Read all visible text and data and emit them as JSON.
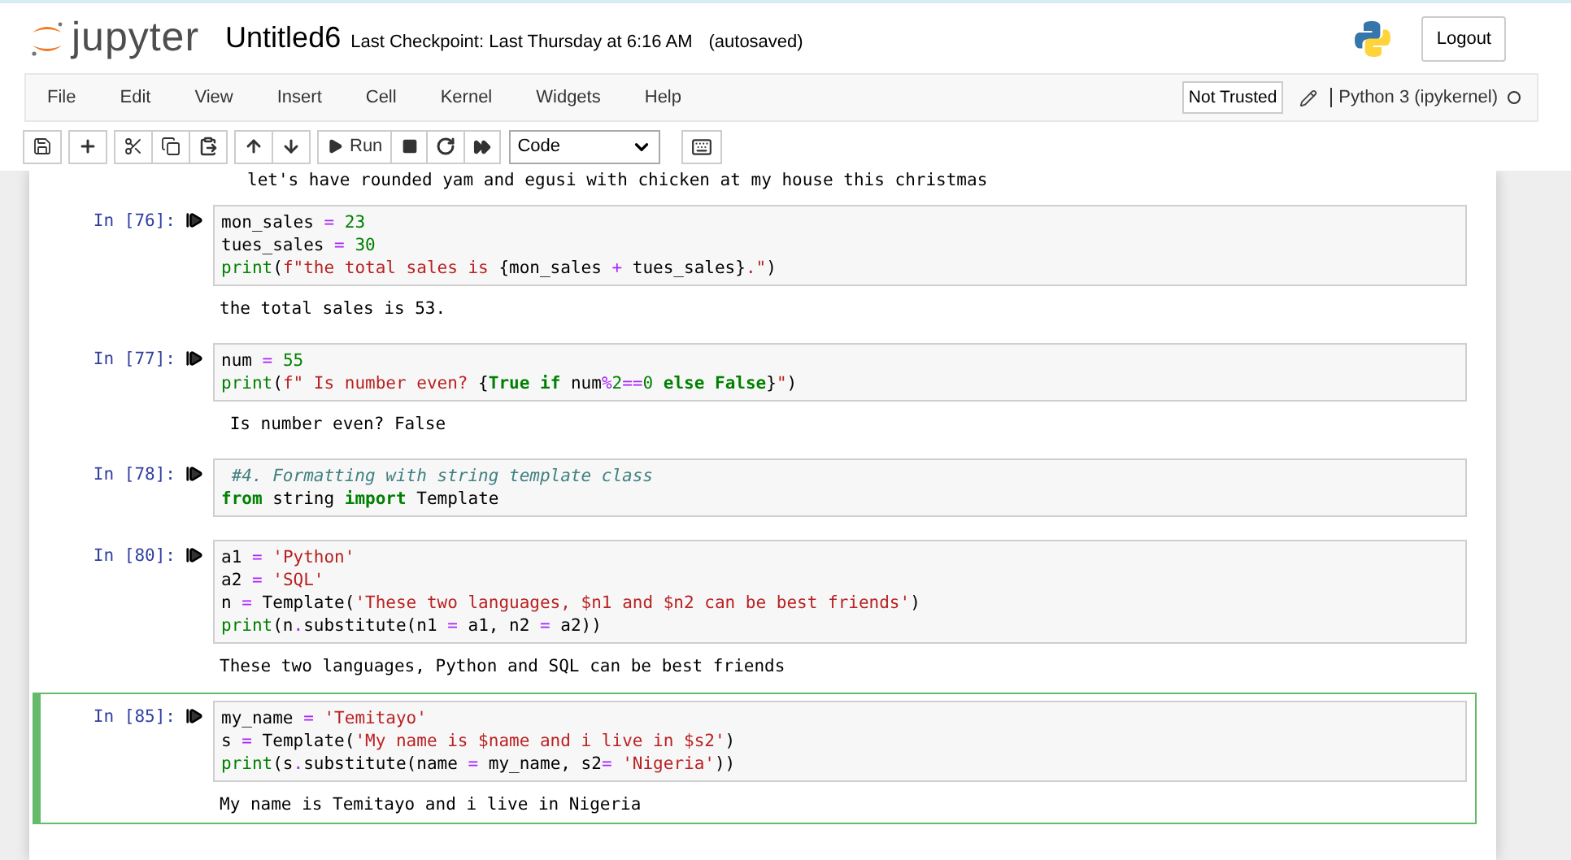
{
  "header": {
    "logo_text": "jupyter",
    "notebook_name": "Untitled6",
    "checkpoint": "Last Checkpoint: Last Thursday at 6:16 AM",
    "save_status": "(autosaved)",
    "logout": "Logout"
  },
  "menu": [
    "File",
    "Edit",
    "View",
    "Insert",
    "Cell",
    "Kernel",
    "Widgets",
    "Help"
  ],
  "trust": "Not Trusted",
  "kernel": {
    "name": "Python 3 (ipykernel)",
    "busy": false
  },
  "toolbar": {
    "run_label": "Run",
    "cell_type": "Code"
  },
  "partial_output": "let's have rounded yam and egusi with chicken at my house this christmas",
  "cells": [
    {
      "prompt": "In [76]:",
      "selected": false,
      "lines": [
        [
          {
            "kind": "plain",
            "text": "mon_sales "
          },
          {
            "kind": "op",
            "text": "="
          },
          {
            "kind": "num",
            "text": " 23"
          }
        ],
        [
          {
            "kind": "plain",
            "text": "tues_sales "
          },
          {
            "kind": "op",
            "text": "="
          },
          {
            "kind": "num",
            "text": " 30"
          }
        ],
        [
          {
            "kind": "builtin",
            "text": "print"
          },
          {
            "kind": "plain",
            "text": "("
          },
          {
            "kind": "str",
            "text": "f\"the total sales is "
          },
          {
            "kind": "plain",
            "text": "{mon_sales "
          },
          {
            "kind": "op",
            "text": "+"
          },
          {
            "kind": "plain",
            "text": " tues_sales}"
          },
          {
            "kind": "str",
            "text": ".\""
          },
          {
            "kind": "plain",
            "text": ")"
          }
        ]
      ],
      "output": "the total sales is 53."
    },
    {
      "prompt": "In [77]:",
      "selected": false,
      "lines": [
        [
          {
            "kind": "plain",
            "text": "num "
          },
          {
            "kind": "op",
            "text": "="
          },
          {
            "kind": "num",
            "text": " 55"
          }
        ],
        [
          {
            "kind": "builtin",
            "text": "print"
          },
          {
            "kind": "plain",
            "text": "("
          },
          {
            "kind": "str",
            "text": "f\" Is number even? "
          },
          {
            "kind": "plain",
            "text": "{"
          },
          {
            "kind": "kw",
            "text": "True"
          },
          {
            "kind": "kw",
            "text": " if"
          },
          {
            "kind": "plain",
            "text": " num"
          },
          {
            "kind": "op",
            "text": "%"
          },
          {
            "kind": "num",
            "text": "2"
          },
          {
            "kind": "op",
            "text": "=="
          },
          {
            "kind": "num",
            "text": "0"
          },
          {
            "kind": "kw",
            "text": " else"
          },
          {
            "kind": "kw",
            "text": " False"
          },
          {
            "kind": "plain",
            "text": "}"
          },
          {
            "kind": "str",
            "text": "\""
          },
          {
            "kind": "plain",
            "text": ")"
          }
        ]
      ],
      "output": " Is number even? False"
    },
    {
      "prompt": "In [78]:",
      "selected": false,
      "lines": [
        [
          {
            "kind": "comment",
            "text": " #4. Formatting with string template class"
          }
        ],
        [
          {
            "kind": "kw",
            "text": "from"
          },
          {
            "kind": "plain",
            "text": " string "
          },
          {
            "kind": "kw",
            "text": "import"
          },
          {
            "kind": "plain",
            "text": " Template"
          }
        ]
      ]
    },
    {
      "prompt": "In [80]:",
      "selected": false,
      "lines": [
        [
          {
            "kind": "plain",
            "text": "a1 "
          },
          {
            "kind": "op",
            "text": "="
          },
          {
            "kind": "str",
            "text": " 'Python'"
          }
        ],
        [
          {
            "kind": "plain",
            "text": "a2 "
          },
          {
            "kind": "op",
            "text": "="
          },
          {
            "kind": "str",
            "text": " 'SQL'"
          }
        ],
        [
          {
            "kind": "plain",
            "text": "n "
          },
          {
            "kind": "op",
            "text": "="
          },
          {
            "kind": "plain",
            "text": " Template("
          },
          {
            "kind": "str",
            "text": "'These two languages, $n1 and $n2 can be best friends'"
          },
          {
            "kind": "plain",
            "text": ")"
          }
        ],
        [
          {
            "kind": "builtin",
            "text": "print"
          },
          {
            "kind": "plain",
            "text": "(n"
          },
          {
            "kind": "op",
            "text": "."
          },
          {
            "kind": "plain",
            "text": "substitute(n1 "
          },
          {
            "kind": "op",
            "text": "="
          },
          {
            "kind": "plain",
            "text": " a1, n2 "
          },
          {
            "kind": "op",
            "text": "="
          },
          {
            "kind": "plain",
            "text": " a2))"
          }
        ]
      ],
      "output": "These two languages, Python and SQL can be best friends"
    },
    {
      "prompt": "In [85]:",
      "selected": true,
      "lines": [
        [
          {
            "kind": "plain",
            "text": "my_name "
          },
          {
            "kind": "op",
            "text": "="
          },
          {
            "kind": "str",
            "text": " 'Temitayo'"
          }
        ],
        [
          {
            "kind": "plain",
            "text": "s "
          },
          {
            "kind": "op",
            "text": "="
          },
          {
            "kind": "plain",
            "text": " Template("
          },
          {
            "kind": "str",
            "text": "'My name is $name and i live in $s2'"
          },
          {
            "kind": "plain",
            "text": ")"
          }
        ],
        [
          {
            "kind": "builtin",
            "text": "print"
          },
          {
            "kind": "plain",
            "text": "(s"
          },
          {
            "kind": "op",
            "text": "."
          },
          {
            "kind": "plain",
            "text": "substitute(name "
          },
          {
            "kind": "op",
            "text": "="
          },
          {
            "kind": "plain",
            "text": " my_name, s2"
          },
          {
            "kind": "op",
            "text": "="
          },
          {
            "kind": "str",
            "text": " 'Nigeria'"
          },
          {
            "kind": "plain",
            "text": "))"
          }
        ]
      ],
      "output": "My name is Temitayo and i live in Nigeria"
    }
  ]
}
